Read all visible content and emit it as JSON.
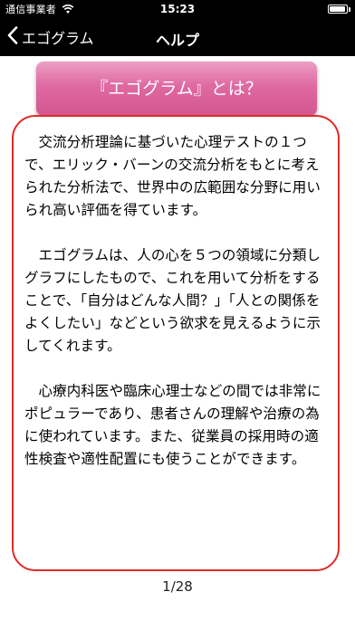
{
  "status_bar": {
    "carrier": "通信事業者",
    "time": "15:23",
    "wifi_icon": "wifi-icon",
    "battery_icon": "battery-icon"
  },
  "nav": {
    "back_icon": "chevron-left-icon",
    "back_label": "エゴグラム",
    "title": "ヘルプ"
  },
  "header_button": {
    "label": "『エゴグラム』とは？",
    "colors": [
      "#ec9fc4",
      "#d4568f"
    ]
  },
  "content": {
    "border_color": "#e02a2a",
    "paragraphs": [
      "交流分析理論に基づいた心理テストの１つで、エリック・バーンの交流分析をもとに考えられた分析法で、世界中の広範囲な分野に用いられ高い評価を得ています。",
      "エゴグラムは、人の心を５つの領域に分類しグラフにしたもので、これを用いて分析をすることで、「自分はどんな人間？」「人との関係をよくしたい」などという欲求を見えるように示してくれます。",
      "心療内科医や臨床心理士などの間では非常にポピュラーであり、患者さんの理解や治療の為に使われています。また、従業員の採用時の適性検査や適性配置にも使うことができます。"
    ]
  },
  "pagination": {
    "label": "1/28"
  }
}
